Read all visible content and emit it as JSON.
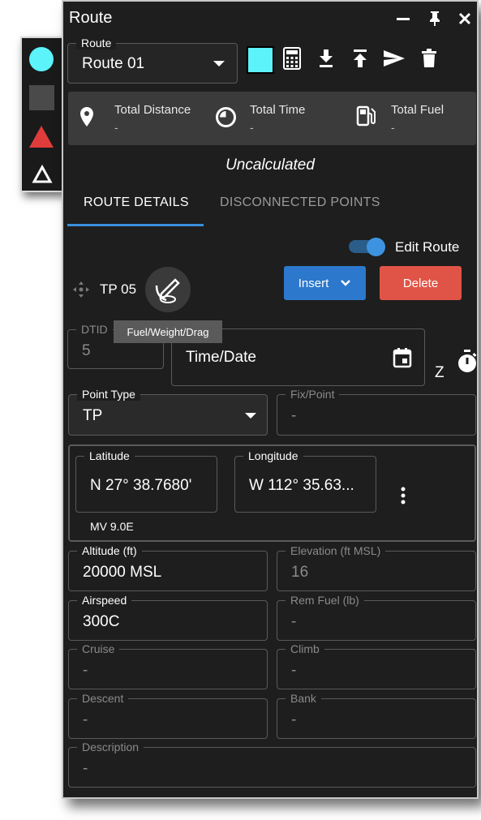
{
  "shapes": [
    "circle",
    "square",
    "triangle",
    "triangle-outline"
  ],
  "colors": {
    "accent": "#3a8ddd",
    "route_color": "#5cf3fb",
    "insert": "#2c78cc",
    "delete": "#e05447",
    "triangle": "#e03c3c"
  },
  "window": {
    "title": "Route",
    "controls": [
      "minimize-icon",
      "pin-icon",
      "close-icon"
    ]
  },
  "route": {
    "label": "Route",
    "value": "Route 01"
  },
  "toolbar_icons": [
    "calculator-icon",
    "download-icon",
    "upload-icon",
    "send-icon",
    "trash-icon"
  ],
  "summary": {
    "distance": {
      "label": "Total Distance",
      "value": "-"
    },
    "time": {
      "label": "Total Time",
      "value": "-"
    },
    "fuel": {
      "label": "Total Fuel",
      "value": "-"
    }
  },
  "status": "Uncalculated",
  "tabs": [
    {
      "label": "ROUTE DETAILS",
      "active": true
    },
    {
      "label": "DISCONNECTED POINTS",
      "active": false
    }
  ],
  "edit_route": {
    "label": "Edit Route",
    "on": true
  },
  "buttons": {
    "insert": "Insert",
    "delete": "Delete"
  },
  "point": {
    "label": "TP 05"
  },
  "tooltip": "Fuel/Weight/Drag",
  "fields": {
    "dtid": {
      "label": "DTID",
      "value": "5"
    },
    "time_date": {
      "placeholder": "Time/Date"
    },
    "zone": "Z",
    "point_type": {
      "label": "Point Type",
      "value": "TP"
    },
    "fix_point": {
      "label": "Fix/Point",
      "value": "-"
    },
    "latitude": {
      "label": "Latitude",
      "value": "N 27° 38.7680'"
    },
    "longitude": {
      "label": "Longitude",
      "value": "W 112° 35.63..."
    },
    "mv": "MV 9.0E",
    "altitude": {
      "label": "Altitude (ft)",
      "value": "20000 MSL"
    },
    "elevation": {
      "label": "Elevation (ft MSL)",
      "value": "16"
    },
    "airspeed": {
      "label": "Airspeed",
      "value": "300C"
    },
    "rem_fuel": {
      "label": "Rem Fuel (lb)",
      "value": "-"
    },
    "cruise": {
      "label": "Cruise",
      "value": "-"
    },
    "climb": {
      "label": "Climb",
      "value": "-"
    },
    "descent": {
      "label": "Descent",
      "value": "-"
    },
    "bank": {
      "label": "Bank",
      "value": "-"
    },
    "description": {
      "label": "Description",
      "value": "-"
    }
  }
}
